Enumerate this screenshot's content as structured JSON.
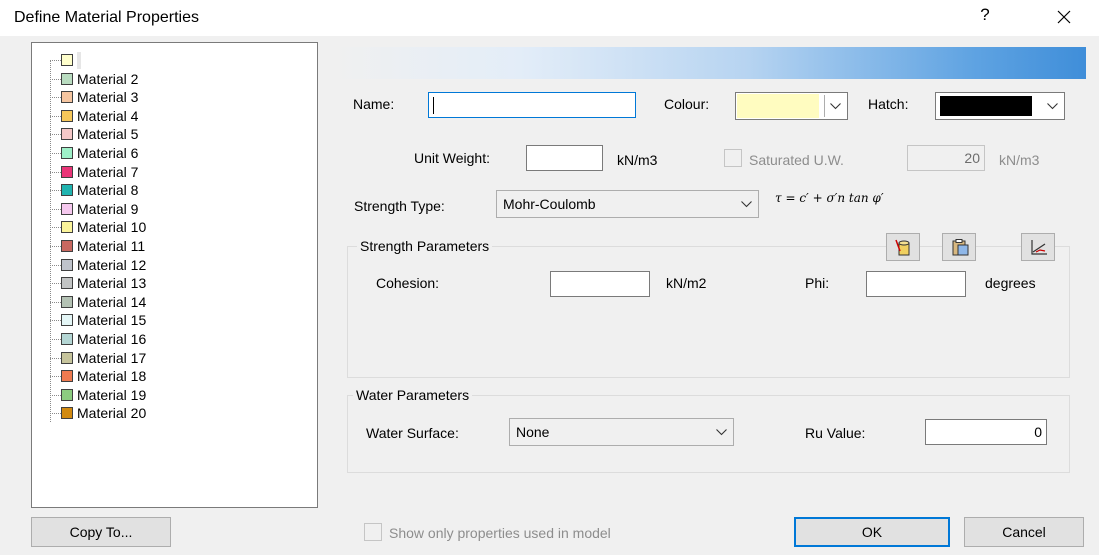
{
  "window": {
    "title": "Define Material Properties",
    "help_label": "?",
    "close_label": "✕"
  },
  "tree": {
    "items": [
      {
        "label": "",
        "color": "#ffffcc"
      },
      {
        "label": "Material 2",
        "color": "#b9dcc0"
      },
      {
        "label": "Material 3",
        "color": "#f5c5a0"
      },
      {
        "label": "Material 4",
        "color": "#f6c75a"
      },
      {
        "label": "Material 5",
        "color": "#f5c8c8"
      },
      {
        "label": "Material 6",
        "color": "#9ef0c8"
      },
      {
        "label": "Material 7",
        "color": "#ea3578"
      },
      {
        "label": "Material 8",
        "color": "#20b4b0"
      },
      {
        "label": "Material 9",
        "color": "#f5c8ee"
      },
      {
        "label": "Material 10",
        "color": "#fbf49a"
      },
      {
        "label": "Material 11",
        "color": "#c86860"
      },
      {
        "label": "Material 12",
        "color": "#bfc3cb"
      },
      {
        "label": "Material 13",
        "color": "#c2c4c4"
      },
      {
        "label": "Material 14",
        "color": "#b4c2b4"
      },
      {
        "label": "Material 15",
        "color": "#e4f6f6"
      },
      {
        "label": "Material 16",
        "color": "#b4d6d4"
      },
      {
        "label": "Material 17",
        "color": "#c6c49c"
      },
      {
        "label": "Material 18",
        "color": "#ee7a50"
      },
      {
        "label": "Material 19",
        "color": "#8ccc80"
      },
      {
        "label": "Material 20",
        "color": "#d28a10"
      }
    ]
  },
  "form": {
    "name_label": "Name:",
    "name_value": "",
    "colour_label": "Colour:",
    "colour_value": "#fffcc0",
    "hatch_label": "Hatch:",
    "hatch_value": "#000000",
    "unit_weight_label": "Unit Weight:",
    "unit_weight_value": "",
    "unit_weight_units": "kN/m3",
    "saturated_label": "Saturated U.W.",
    "saturated_value": "20",
    "saturated_units": "kN/m3",
    "strength_type_label": "Strength Type:",
    "strength_type_value": "Mohr-Coulomb",
    "formula": "τ = c′ + σ′n tan φ′",
    "strength_params_title": "Strength Parameters",
    "cohesion_label": "Cohesion:",
    "cohesion_value": "",
    "cohesion_units": "kN/m2",
    "phi_label": "Phi:",
    "phi_value": "",
    "phi_units": "degrees",
    "water_params_title": "Water Parameters",
    "water_surface_label": "Water Surface:",
    "water_surface_value": "None",
    "ru_label": "Ru Value:",
    "ru_value": "0"
  },
  "footer": {
    "copy_to_label": "Copy To...",
    "show_only_label": "Show only properties used in model",
    "ok_label": "OK",
    "cancel_label": "Cancel"
  },
  "icons": [
    "database-icon",
    "clipboard-icon",
    "graph-icon"
  ]
}
